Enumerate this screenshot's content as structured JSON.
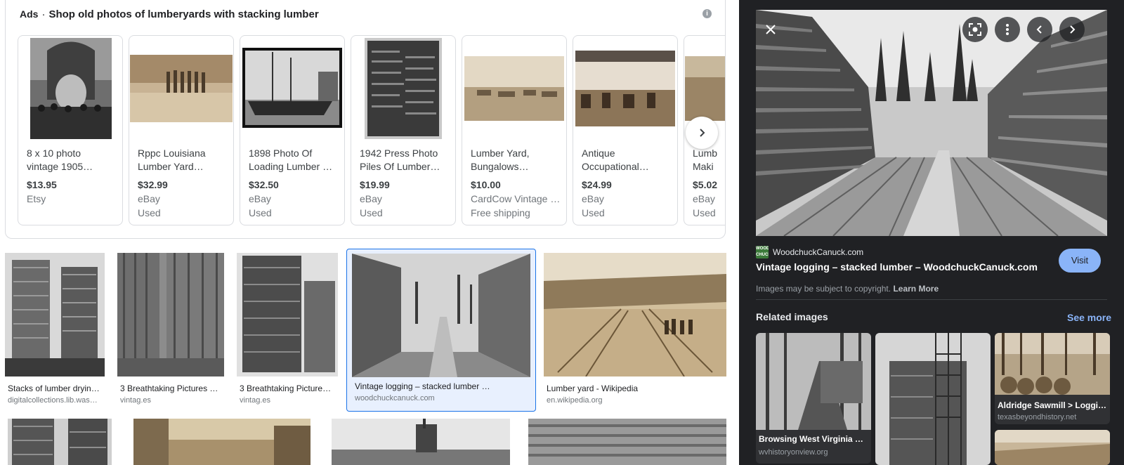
{
  "ads": {
    "label": "Ads",
    "separator": "·",
    "headline": "Shop old photos of lumberyards with stacking lumber",
    "info_icon": "info-icon",
    "next_icon": "chevron-right-icon",
    "items": [
      {
        "name_l1": "8 x 10 photo",
        "name_l2": "vintage 1905…",
        "price": "$13.95",
        "seller": "Etsy",
        "condition": ""
      },
      {
        "name_l1": "Rppc Louisiana",
        "name_l2": "Lumber Yard…",
        "price": "$32.99",
        "seller": "eBay",
        "condition": "Used"
      },
      {
        "name_l1": "1898 Photo Of",
        "name_l2": "Loading Lumber O…",
        "price": "$32.50",
        "seller": "eBay",
        "condition": "Used"
      },
      {
        "name_l1": "1942 Press Photo",
        "name_l2": "Piles Of Lumber…",
        "price": "$19.99",
        "seller": "eBay",
        "condition": "Used"
      },
      {
        "name_l1": "Lumber Yard,",
        "name_l2": "Bungalows…",
        "price": "$10.00",
        "seller": "CardCow Vintage …",
        "condition": "Free shipping"
      },
      {
        "name_l1": "Antique",
        "name_l2": "Occupational…",
        "price": "$24.99",
        "seller": "eBay",
        "condition": "Used"
      },
      {
        "name_l1": "Lumb",
        "name_l2": "Maki",
        "price": "$5.02",
        "seller": "eBay",
        "condition": "Used"
      }
    ]
  },
  "results_row1": [
    {
      "title": "Stacks of lumber dryin…",
      "source": "digitalcollections.lib.was…"
    },
    {
      "title": "3 Breathtaking Pictures o…",
      "source": "vintag.es"
    },
    {
      "title": "3 Breathtaking Pictures…",
      "source": "vintag.es"
    },
    {
      "title": "Vintage logging – stacked lumber …",
      "source": "woodchuckcanuck.com"
    },
    {
      "title": "Lumber yard - Wikipedia",
      "source": "en.wikipedia.org"
    }
  ],
  "panel": {
    "close_icon": "close-icon",
    "lens_icon": "lens-icon",
    "more_icon": "more-vert-icon",
    "prev_icon": "chevron-left-icon",
    "next_icon": "chevron-right-icon",
    "favicon_text": "WOOD CHUCK",
    "site_name": "WoodchuckCanuck.com",
    "title": "Vintage logging – stacked lumber – WoodchuckCanuck.com",
    "visit_label": "Visit",
    "copyright_text": "Images may be subject to copyright.",
    "learn_more": "Learn More",
    "related_heading": "Related images",
    "see_more": "See more",
    "related": [
      {
        "caption": "Browsing West Virginia His…",
        "source": "wvhistoryonview.org"
      },
      {
        "caption": "",
        "source": ""
      },
      {
        "caption": "Aldridge Sawmill > Logging…",
        "source": "texasbeyondhistory.net"
      },
      {
        "caption": "",
        "source": ""
      }
    ]
  },
  "colors": {
    "accent_blue": "#1a73e8",
    "panel_bg": "#202124",
    "visit_btn": "#8ab4f8",
    "selected_bg": "#e8f0fe"
  }
}
